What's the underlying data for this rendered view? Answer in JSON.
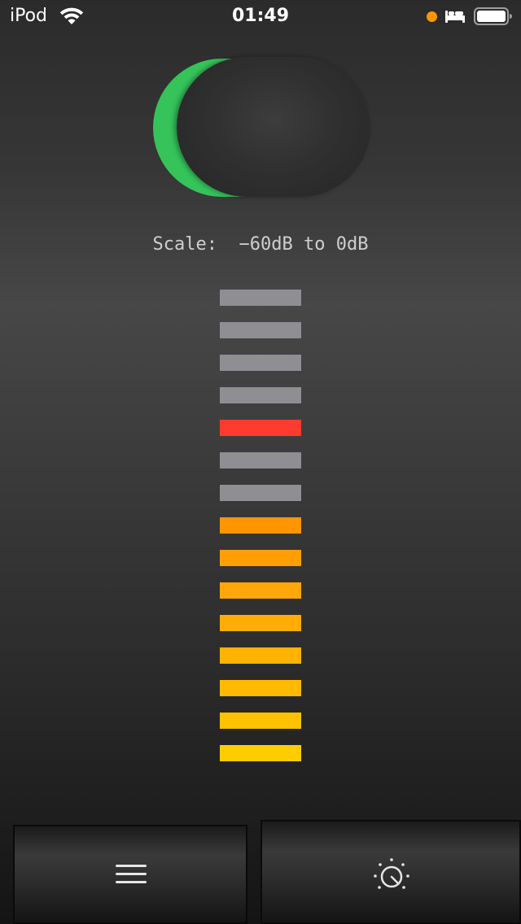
{
  "status_bar": {
    "carrier": "iPod",
    "time": "01:49",
    "indicator_color": "#ff9500"
  },
  "power_toggle": {
    "state": "on",
    "on_color": "#35c35a"
  },
  "scale": {
    "label": "Scale:  −60dB to 0dB"
  },
  "meter": {
    "segments": [
      {
        "color": "#8e8e93"
      },
      {
        "color": "#8e8e93"
      },
      {
        "color": "#8e8e93"
      },
      {
        "color": "#8e8e93"
      },
      {
        "color": "#ff3b30"
      },
      {
        "color": "#8e8e93"
      },
      {
        "color": "#8e8e93"
      },
      {
        "color": "#ff9500"
      },
      {
        "color": "#ff9f05"
      },
      {
        "color": "#ffa60a"
      },
      {
        "color": "#ffad05"
      },
      {
        "color": "#ffb300"
      },
      {
        "color": "#ffba00"
      },
      {
        "color": "#ffc200"
      },
      {
        "color": "#ffcc00"
      }
    ]
  },
  "bottom_bar": {
    "menu_icon": "hamburger-menu-icon",
    "meter_icon": "dial-gauge-icon"
  }
}
